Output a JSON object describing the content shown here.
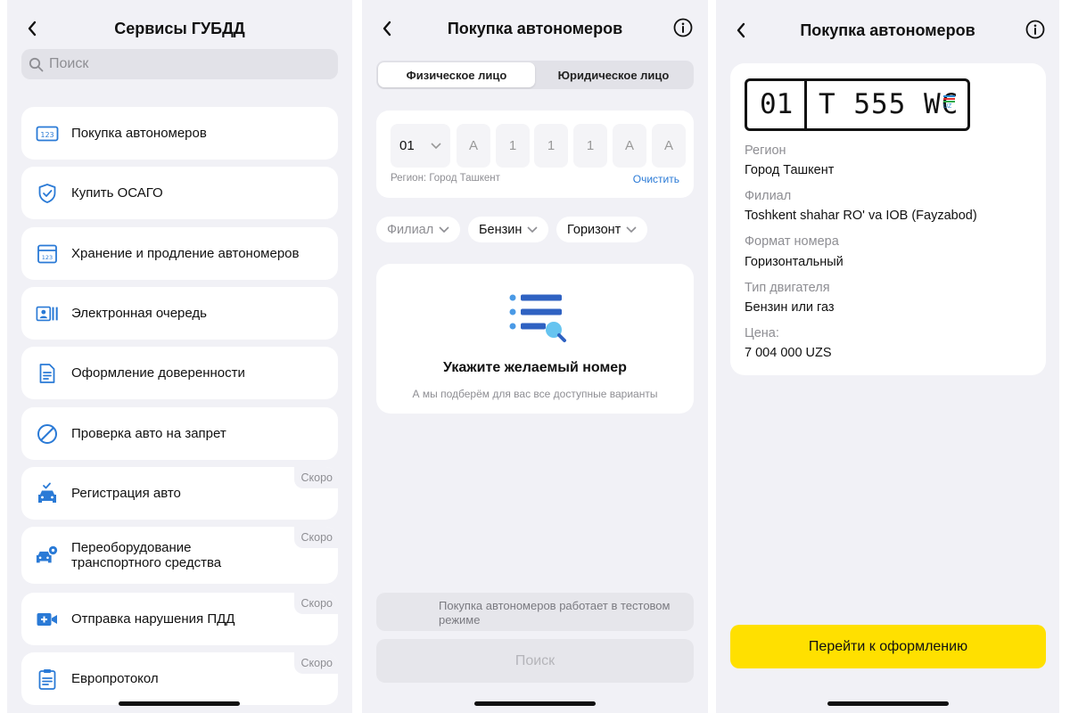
{
  "colors": {
    "accent_blue": "#2a7ad6",
    "cta_yellow": "#ffe000",
    "background": "#f1f1f6"
  },
  "screen1": {
    "title": "Сервисы ГУБДД",
    "search_placeholder": "Поиск",
    "items": [
      {
        "label": "Покупка автономеров",
        "icon": "plate-123-icon",
        "soon": ""
      },
      {
        "label": "Купить ОСАГО",
        "icon": "shield-check-icon",
        "soon": ""
      },
      {
        "label": "Хранение и продление автономеров",
        "icon": "plate-storage-icon",
        "soon": ""
      },
      {
        "label": "Электронная очередь",
        "icon": "queue-id-icon",
        "soon": ""
      },
      {
        "label": "Оформление доверенности",
        "icon": "document-icon",
        "soon": ""
      },
      {
        "label": "Проверка авто на запрет",
        "icon": "prohibited-icon",
        "soon": ""
      },
      {
        "label": "Регистрация авто",
        "icon": "car-check-icon",
        "soon": "Скоро"
      },
      {
        "label": "Переоборудование\nтранспортного средства",
        "icon": "car-gear-icon",
        "soon": "Скоро"
      },
      {
        "label": "Отправка нарушения ПДД",
        "icon": "video-plus-icon",
        "soon": "Скоро"
      },
      {
        "label": "Европротокол",
        "icon": "clipboard-icon",
        "soon": "Скоро"
      }
    ]
  },
  "screen2": {
    "title": "Покупка автономеров",
    "tabs": [
      "Физическое лицо",
      "Юридическое лицо"
    ],
    "region_code": "01",
    "plate_chars": [
      "A",
      "1",
      "1",
      "1",
      "A",
      "A"
    ],
    "region_hint": "Регион: Город Ташкент",
    "clear_label": "Очистить",
    "filters": [
      "Филиал",
      "Бензин",
      "Горизонт"
    ],
    "empty_title": "Укажите желаемый номер",
    "empty_subtitle": "А мы подберём для вас все доступные варианты",
    "test_notice": "Покупка автономеров работает в тестовом режиме",
    "search_button": "Поиск"
  },
  "screen3": {
    "title": "Покупка автономеров",
    "plate_region": "01",
    "plate_number": "T 555 WC",
    "plate_country": "UZ",
    "details": [
      {
        "label": "Регион",
        "value": "Город Ташкент"
      },
      {
        "label": "Филиал",
        "value": "Toshkent shahar RO' va IOB (Fayzabod)"
      },
      {
        "label": "Формат номера",
        "value": "Горизонтальный"
      },
      {
        "label": "Тип двигателя",
        "value": "Бензин или газ"
      },
      {
        "label": "Цена:",
        "value": "7 004 000 UZS"
      }
    ],
    "cta_button": "Перейти к оформлению"
  }
}
